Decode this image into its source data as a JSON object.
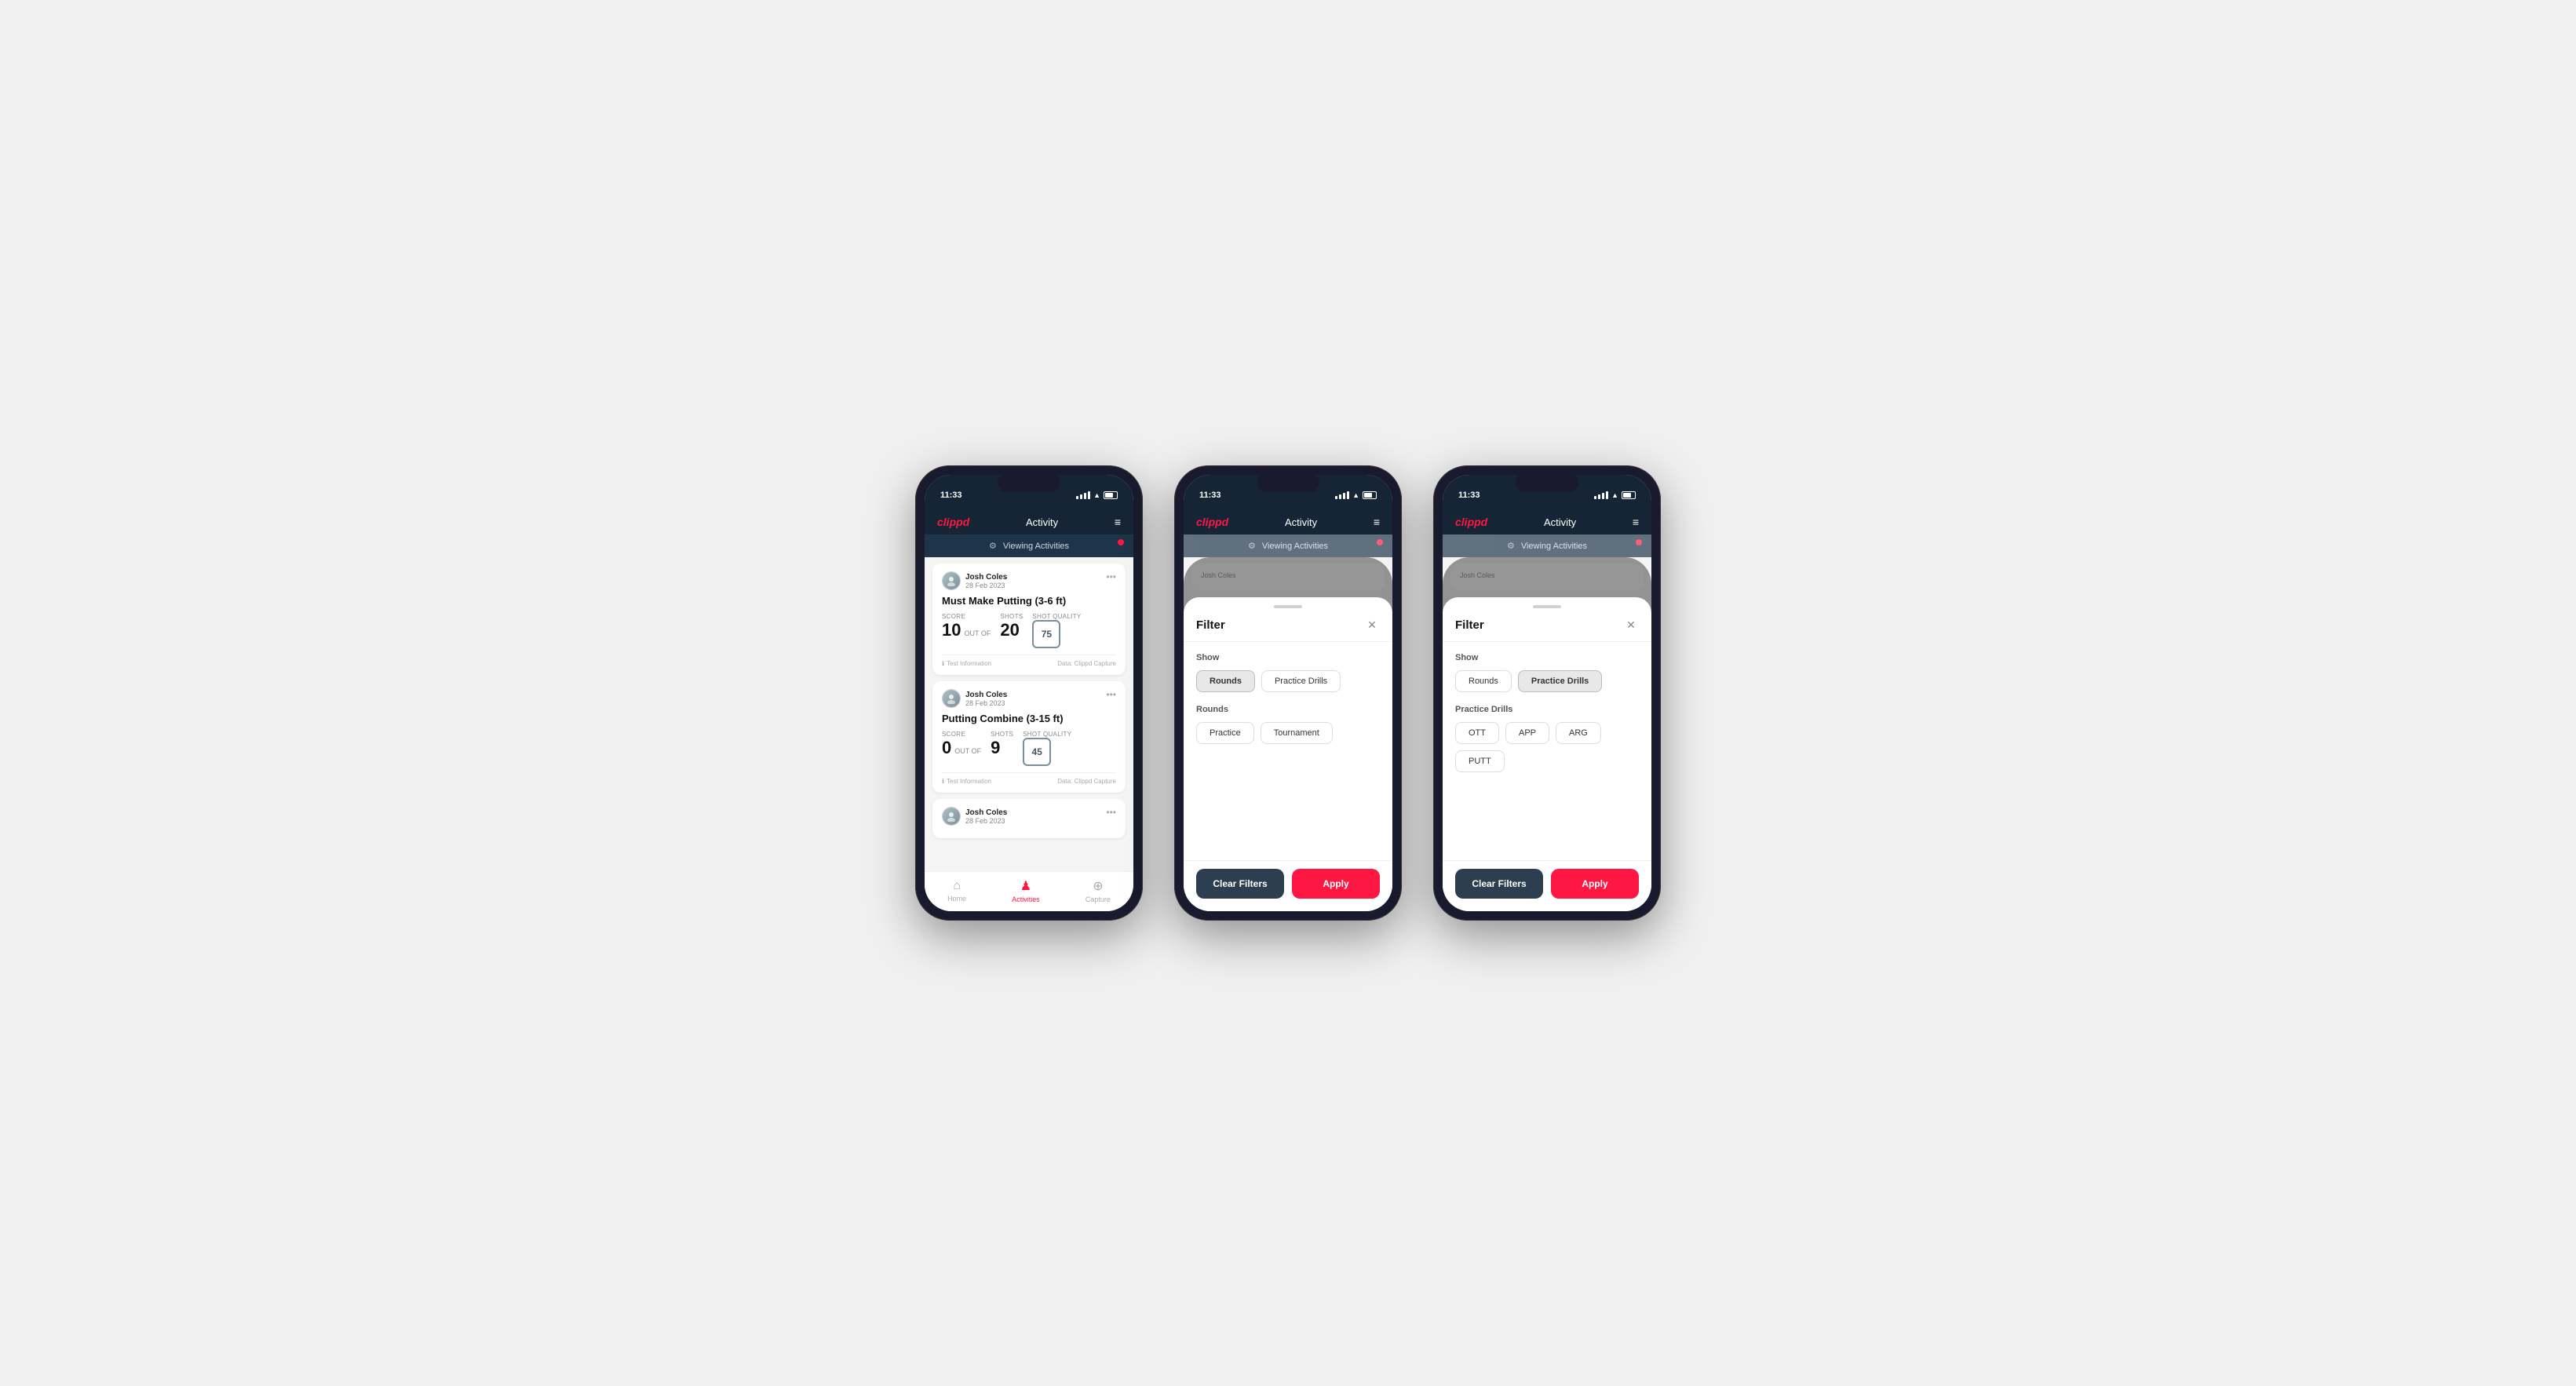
{
  "app": {
    "logo": "clippd",
    "nav_title": "Activity",
    "status_time": "11:33",
    "hamburger": "≡"
  },
  "viewing_bar": {
    "text": "Viewing Activities",
    "icon": "⚙"
  },
  "phone1": {
    "cards": [
      {
        "user_name": "Josh Coles",
        "user_date": "28 Feb 2023",
        "title": "Must Make Putting (3-6 ft)",
        "score_label": "Score",
        "score_value": "10",
        "out_of_label": "OUT OF",
        "shots_label": "Shots",
        "shots_value": "20",
        "sq_label": "Shot Quality",
        "sq_value": "75",
        "info_text": "Test Information",
        "data_text": "Data: Clippd Capture"
      },
      {
        "user_name": "Josh Coles",
        "user_date": "28 Feb 2023",
        "title": "Putting Combine (3-15 ft)",
        "score_label": "Score",
        "score_value": "0",
        "out_of_label": "OUT OF",
        "shots_label": "Shots",
        "shots_value": "9",
        "sq_label": "Shot Quality",
        "sq_value": "45",
        "info_text": "Test Information",
        "data_text": "Data: Clippd Capture"
      },
      {
        "user_name": "Josh Coles",
        "user_date": "28 Feb 2023",
        "title": "",
        "score_label": "",
        "score_value": "",
        "out_of_label": "",
        "shots_label": "",
        "shots_value": "",
        "sq_label": "",
        "sq_value": "",
        "info_text": "",
        "data_text": ""
      }
    ],
    "bottom_nav": [
      {
        "label": "Home",
        "icon": "⌂",
        "active": false
      },
      {
        "label": "Activities",
        "icon": "♟",
        "active": true
      },
      {
        "label": "Capture",
        "icon": "⊕",
        "active": false
      }
    ]
  },
  "phone2": {
    "filter": {
      "title": "Filter",
      "show_label": "Show",
      "show_options": [
        {
          "label": "Rounds",
          "active": true
        },
        {
          "label": "Practice Drills",
          "active": false
        }
      ],
      "rounds_label": "Rounds",
      "rounds_options": [
        {
          "label": "Practice",
          "active": false
        },
        {
          "label": "Tournament",
          "active": false
        }
      ],
      "clear_label": "Clear Filters",
      "apply_label": "Apply"
    }
  },
  "phone3": {
    "filter": {
      "title": "Filter",
      "show_label": "Show",
      "show_options": [
        {
          "label": "Rounds",
          "active": false
        },
        {
          "label": "Practice Drills",
          "active": true
        }
      ],
      "drills_label": "Practice Drills",
      "drills_options": [
        {
          "label": "OTT",
          "active": false
        },
        {
          "label": "APP",
          "active": false
        },
        {
          "label": "ARG",
          "active": false
        },
        {
          "label": "PUTT",
          "active": false
        }
      ],
      "clear_label": "Clear Filters",
      "apply_label": "Apply"
    }
  }
}
